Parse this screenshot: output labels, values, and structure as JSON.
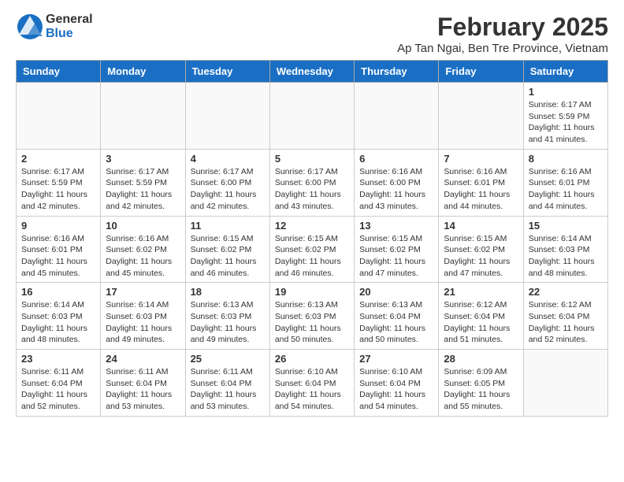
{
  "logo": {
    "general": "General",
    "blue": "Blue"
  },
  "title": "February 2025",
  "subtitle": "Ap Tan Ngai, Ben Tre Province, Vietnam",
  "days_of_week": [
    "Sunday",
    "Monday",
    "Tuesday",
    "Wednesday",
    "Thursday",
    "Friday",
    "Saturday"
  ],
  "weeks": [
    [
      {
        "day": "",
        "info": ""
      },
      {
        "day": "",
        "info": ""
      },
      {
        "day": "",
        "info": ""
      },
      {
        "day": "",
        "info": ""
      },
      {
        "day": "",
        "info": ""
      },
      {
        "day": "",
        "info": ""
      },
      {
        "day": "1",
        "info": "Sunrise: 6:17 AM\nSunset: 5:59 PM\nDaylight: 11 hours\nand 41 minutes."
      }
    ],
    [
      {
        "day": "2",
        "info": "Sunrise: 6:17 AM\nSunset: 5:59 PM\nDaylight: 11 hours\nand 42 minutes."
      },
      {
        "day": "3",
        "info": "Sunrise: 6:17 AM\nSunset: 5:59 PM\nDaylight: 11 hours\nand 42 minutes."
      },
      {
        "day": "4",
        "info": "Sunrise: 6:17 AM\nSunset: 6:00 PM\nDaylight: 11 hours\nand 42 minutes."
      },
      {
        "day": "5",
        "info": "Sunrise: 6:17 AM\nSunset: 6:00 PM\nDaylight: 11 hours\nand 43 minutes."
      },
      {
        "day": "6",
        "info": "Sunrise: 6:16 AM\nSunset: 6:00 PM\nDaylight: 11 hours\nand 43 minutes."
      },
      {
        "day": "7",
        "info": "Sunrise: 6:16 AM\nSunset: 6:01 PM\nDaylight: 11 hours\nand 44 minutes."
      },
      {
        "day": "8",
        "info": "Sunrise: 6:16 AM\nSunset: 6:01 PM\nDaylight: 11 hours\nand 44 minutes."
      }
    ],
    [
      {
        "day": "9",
        "info": "Sunrise: 6:16 AM\nSunset: 6:01 PM\nDaylight: 11 hours\nand 45 minutes."
      },
      {
        "day": "10",
        "info": "Sunrise: 6:16 AM\nSunset: 6:02 PM\nDaylight: 11 hours\nand 45 minutes."
      },
      {
        "day": "11",
        "info": "Sunrise: 6:15 AM\nSunset: 6:02 PM\nDaylight: 11 hours\nand 46 minutes."
      },
      {
        "day": "12",
        "info": "Sunrise: 6:15 AM\nSunset: 6:02 PM\nDaylight: 11 hours\nand 46 minutes."
      },
      {
        "day": "13",
        "info": "Sunrise: 6:15 AM\nSunset: 6:02 PM\nDaylight: 11 hours\nand 47 minutes."
      },
      {
        "day": "14",
        "info": "Sunrise: 6:15 AM\nSunset: 6:02 PM\nDaylight: 11 hours\nand 47 minutes."
      },
      {
        "day": "15",
        "info": "Sunrise: 6:14 AM\nSunset: 6:03 PM\nDaylight: 11 hours\nand 48 minutes."
      }
    ],
    [
      {
        "day": "16",
        "info": "Sunrise: 6:14 AM\nSunset: 6:03 PM\nDaylight: 11 hours\nand 48 minutes."
      },
      {
        "day": "17",
        "info": "Sunrise: 6:14 AM\nSunset: 6:03 PM\nDaylight: 11 hours\nand 49 minutes."
      },
      {
        "day": "18",
        "info": "Sunrise: 6:13 AM\nSunset: 6:03 PM\nDaylight: 11 hours\nand 49 minutes."
      },
      {
        "day": "19",
        "info": "Sunrise: 6:13 AM\nSunset: 6:03 PM\nDaylight: 11 hours\nand 50 minutes."
      },
      {
        "day": "20",
        "info": "Sunrise: 6:13 AM\nSunset: 6:04 PM\nDaylight: 11 hours\nand 50 minutes."
      },
      {
        "day": "21",
        "info": "Sunrise: 6:12 AM\nSunset: 6:04 PM\nDaylight: 11 hours\nand 51 minutes."
      },
      {
        "day": "22",
        "info": "Sunrise: 6:12 AM\nSunset: 6:04 PM\nDaylight: 11 hours\nand 52 minutes."
      }
    ],
    [
      {
        "day": "23",
        "info": "Sunrise: 6:11 AM\nSunset: 6:04 PM\nDaylight: 11 hours\nand 52 minutes."
      },
      {
        "day": "24",
        "info": "Sunrise: 6:11 AM\nSunset: 6:04 PM\nDaylight: 11 hours\nand 53 minutes."
      },
      {
        "day": "25",
        "info": "Sunrise: 6:11 AM\nSunset: 6:04 PM\nDaylight: 11 hours\nand 53 minutes."
      },
      {
        "day": "26",
        "info": "Sunrise: 6:10 AM\nSunset: 6:04 PM\nDaylight: 11 hours\nand 54 minutes."
      },
      {
        "day": "27",
        "info": "Sunrise: 6:10 AM\nSunset: 6:04 PM\nDaylight: 11 hours\nand 54 minutes."
      },
      {
        "day": "28",
        "info": "Sunrise: 6:09 AM\nSunset: 6:05 PM\nDaylight: 11 hours\nand 55 minutes."
      },
      {
        "day": "",
        "info": ""
      }
    ]
  ]
}
